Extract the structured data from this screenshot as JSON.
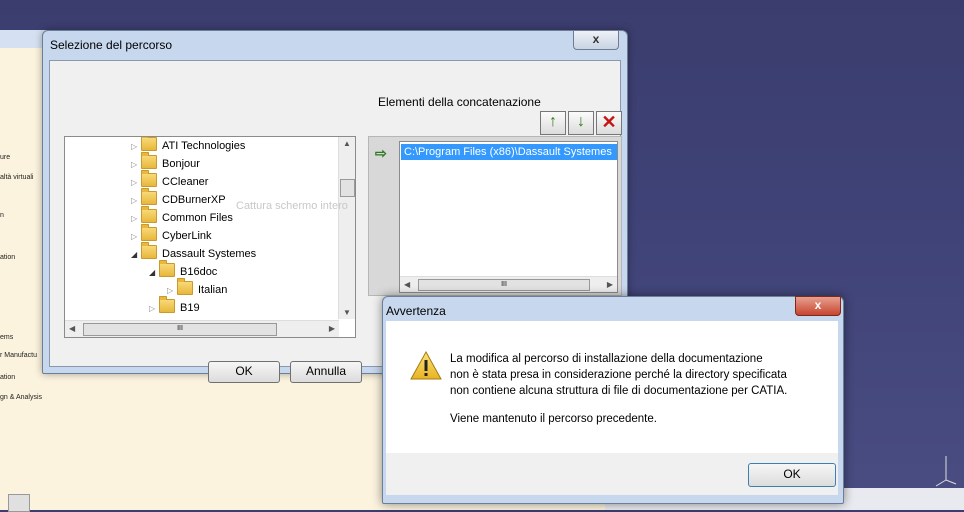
{
  "background_app": {
    "tree_items": [
      "ure",
      "altà virtuali",
      "n",
      "ation",
      "ems",
      "r Manufactu",
      "ation",
      "gn & Analysis"
    ]
  },
  "path_dialog": {
    "title": "Selezione del percorso",
    "close_label": "x",
    "tree": [
      {
        "label": "ATI Technologies",
        "level": 0,
        "expanded": false
      },
      {
        "label": "Bonjour",
        "level": 0,
        "expanded": false
      },
      {
        "label": "CCleaner",
        "level": 0,
        "expanded": false
      },
      {
        "label": "CDBurnerXP",
        "level": 0,
        "expanded": false
      },
      {
        "label": "Common Files",
        "level": 0,
        "expanded": false
      },
      {
        "label": "CyberLink",
        "level": 0,
        "expanded": false
      },
      {
        "label": "Dassault Systemes",
        "level": 0,
        "expanded": true
      },
      {
        "label": "B16doc",
        "level": 1,
        "expanded": true
      },
      {
        "label": "Italian",
        "level": 2,
        "expanded": false
      },
      {
        "label": "B19",
        "level": 1,
        "expanded": false
      }
    ],
    "scroll_thumb_label": "III",
    "concat_label": "Elementi della concatenazione",
    "concat_items": [
      "C:\\Program Files (x86)\\Dassault Systemes"
    ],
    "ok_label": "OK",
    "cancel_label": "Annulla",
    "watermark": "Cattura schermo intero"
  },
  "warning_dialog": {
    "title": "Avvertenza",
    "close_label": "x",
    "lines": [
      "La modifica al percorso di installazione della documentazione",
      "non è stata presa in considerazione perché la directory specificata",
      "non contiene alcuna struttura di file di documentazione per CATIA.",
      "Viene mantenuto il percorso precedente."
    ],
    "ok_label": "OK"
  },
  "icons": {
    "up": "↑",
    "down": "↓",
    "delete": "✕",
    "selected_arrow": "⇨"
  }
}
